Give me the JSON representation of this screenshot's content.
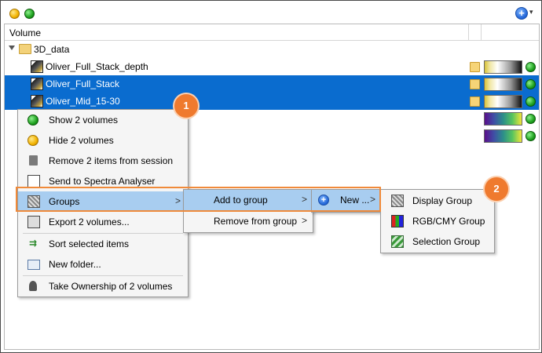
{
  "window": {
    "controls": {
      "minimize": "yellow-dot-icon",
      "maximize": "green-dot-icon"
    },
    "add_button_glyph": "+",
    "chevron_glyph": "▾"
  },
  "tree": {
    "header": {
      "column_name": "Volume"
    },
    "folder": {
      "label": "3D_data"
    },
    "rows": [
      {
        "label": "Oliver_Full_Stack_depth",
        "selected": false,
        "ramp": "gray"
      },
      {
        "label": "Oliver_Full_Stack",
        "selected": true,
        "ramp": "gray"
      },
      {
        "label": "Oliver_Mid_15-30",
        "selected": true,
        "ramp": "gray"
      },
      {
        "label": "",
        "selected": false,
        "ramp": "viridis"
      },
      {
        "label": "",
        "selected": false,
        "ramp": "viridis"
      }
    ]
  },
  "context_menu": {
    "items": [
      {
        "label": "Show 2 volumes",
        "icon": "green-dot-icon"
      },
      {
        "label": "Hide 2 volumes",
        "icon": "yellow-dot-icon"
      },
      {
        "label": "Remove 2 items from session",
        "icon": "trash-icon"
      },
      {
        "label": "Send to Spectra Analyser",
        "icon": "spectra-icon"
      },
      {
        "label": "Groups",
        "icon": "groups-icon",
        "arrow": ">"
      },
      {
        "label": "Export 2 volumes...",
        "icon": "export-icon"
      },
      {
        "label": "Sort selected items",
        "icon": "sort-icon"
      },
      {
        "label": "New folder...",
        "icon": "folder-icon"
      },
      {
        "label": "Take Ownership of 2 volumes",
        "icon": "user-icon"
      }
    ]
  },
  "groups_menu": {
    "items": [
      {
        "label": "Add to group",
        "arrow": ">"
      },
      {
        "label": "Remove from group",
        "arrow": ">"
      }
    ]
  },
  "add_menu": {
    "items": [
      {
        "label": "New ...",
        "arrow": ">",
        "icon": "plus-icon"
      }
    ]
  },
  "new_menu": {
    "items": [
      {
        "label": "Display Group",
        "icon": "groups-icon"
      },
      {
        "label": "RGB/CMY Group",
        "icon": "rgb-icon"
      },
      {
        "label": "Selection Group",
        "icon": "selection-group-icon"
      }
    ]
  },
  "callouts": {
    "one": "1",
    "two": "2"
  },
  "colors": {
    "selection": "#0a6ccf",
    "highlight": "#a8cdf0",
    "callout": "#ef7a2e"
  }
}
